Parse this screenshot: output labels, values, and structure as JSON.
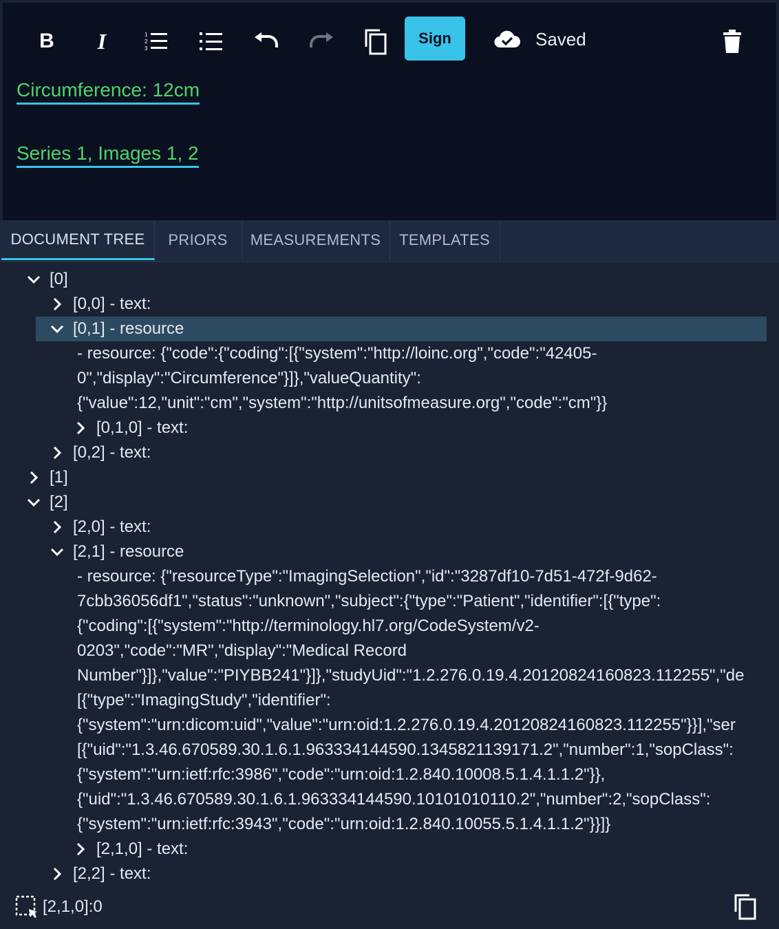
{
  "toolbar": {
    "bold": "bold-icon",
    "italic": "italic-icon",
    "ordered_list": "ordered-list-icon",
    "bullet_list": "bullet-list-icon",
    "undo": "undo-icon",
    "redo": "redo-icon",
    "copy": "copy-icon",
    "sign_label": "Sign",
    "saved_label": "Saved",
    "delete": "trash-icon",
    "accent": "#39c3e8"
  },
  "document": {
    "lines": [
      "Circumference:  12cm",
      "Series 1, Images 1, 2"
    ],
    "text_color": "#4fd36b"
  },
  "tabs": [
    {
      "label": "DOCUMENT TREE",
      "active": true
    },
    {
      "label": "PRIORS",
      "active": false
    },
    {
      "label": "MEASUREMENTS",
      "active": false
    },
    {
      "label": "TEMPLATES",
      "active": false
    }
  ],
  "tree": {
    "nodes": [
      {
        "label": "[0]",
        "expanded": true
      },
      {
        "label": "[0,0] - text:",
        "expanded": false
      },
      {
        "label": "[0,1] - resource",
        "expanded": true,
        "selected": true
      },
      {
        "label": "[0,1,0] - text:",
        "expanded": false
      },
      {
        "label": "[0,2] - text:",
        "expanded": false
      },
      {
        "label": "[1]",
        "expanded": false
      },
      {
        "label": "[2]",
        "expanded": true
      },
      {
        "label": "[2,0] - text:",
        "expanded": false
      },
      {
        "label": "[2,1] - resource",
        "expanded": true
      },
      {
        "label": "[2,1,0] - text:",
        "expanded": false
      },
      {
        "label": "[2,2] - text:",
        "expanded": false
      }
    ],
    "resource_0_1": [
      "- resource: {\"code\":{\"coding\":[{\"system\":\"http://loinc.org\",\"code\":\"42405-",
      "0\",\"display\":\"Circumference\"}]},\"valueQuantity\":",
      "{\"value\":12,\"unit\":\"cm\",\"system\":\"http://unitsofmeasure.org\",\"code\":\"cm\"}}"
    ],
    "resource_2_1": [
      "- resource: {\"resourceType\":\"ImagingSelection\",\"id\":\"3287df10-7d51-472f-9d62-",
      "7cbb36056df1\",\"status\":\"unknown\",\"subject\":{\"type\":\"Patient\",\"identifier\":[{\"type\":",
      "{\"coding\":[{\"system\":\"http://terminology.hl7.org/CodeSystem/v2-",
      "0203\",\"code\":\"MR\",\"display\":\"Medical Record",
      "Number\"}]},\"value\":\"PIYBB241\"}]},\"studyUid\":\"1.2.276.0.19.4.20120824160823.112255\",\"de",
      "[{\"type\":\"ImagingStudy\",\"identifier\":",
      "{\"system\":\"urn:dicom:uid\",\"value\":\"urn:oid:1.2.276.0.19.4.20120824160823.112255\"}}],\"ser",
      "[{\"uid\":\"1.3.46.670589.30.1.6.1.963334144590.1345821139171.2\",\"number\":1,\"sopClass\":",
      "{\"system\":\"urn:ietf:rfc:3986\",\"code\":\"urn:oid:1.2.840.10008.5.1.4.1.1.2\"}},",
      "{\"uid\":\"1.3.46.670589.30.1.6.1.963334144590.10101010110.2\",\"number\":2,\"sopClass\":",
      "{\"system\":\"urn:ietf:rfc:3943\",\"code\":\"urn:oid:1.2.840.10055.5.1.4.1.1.2\"}}]}"
    ]
  },
  "status": {
    "cursor_path": "[2,1,0]:0",
    "selection_icon": "selection-cursor-icon",
    "copy_icon": "copy-icon"
  }
}
